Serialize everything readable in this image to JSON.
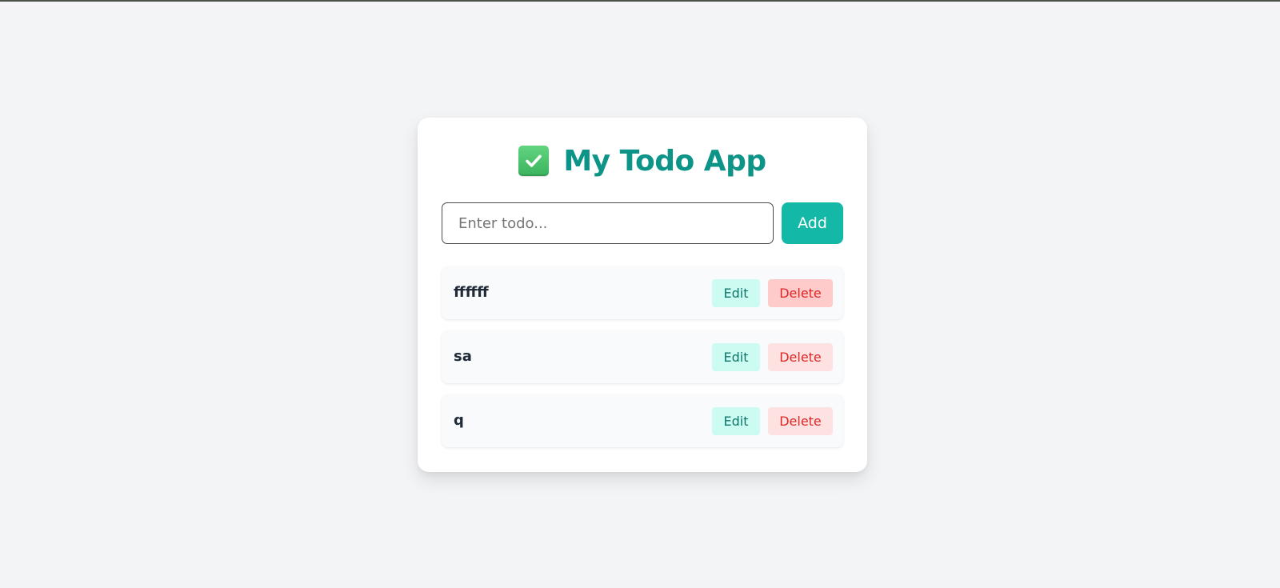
{
  "app": {
    "title": "My Todo App",
    "title_icon": "check-mark-button-icon"
  },
  "input": {
    "placeholder": "Enter todo...",
    "value": ""
  },
  "add_button": {
    "label": "Add"
  },
  "todos": [
    {
      "text": "ffffff",
      "edit_label": "Edit",
      "delete_label": "Delete",
      "delete_hovered": true
    },
    {
      "text": "sa",
      "edit_label": "Edit",
      "delete_label": "Delete",
      "delete_hovered": false
    },
    {
      "text": "q",
      "edit_label": "Edit",
      "delete_label": "Delete",
      "delete_hovered": false
    }
  ],
  "colors": {
    "accent": "#0d9488",
    "add_button": "#14b8a6",
    "edit_bg": "#ccfbf1",
    "edit_text": "#0f766e",
    "delete_bg": "#fee2e2",
    "delete_bg_hover": "#fecaca",
    "delete_text": "#dc2626",
    "page_bg": "#f3f4f6"
  }
}
